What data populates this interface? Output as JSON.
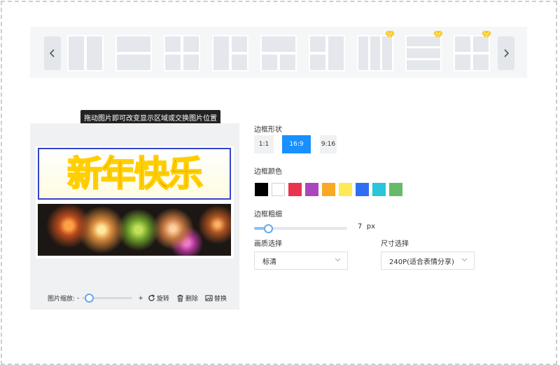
{
  "template_strip": {
    "prev_icon": "chevron-left-icon",
    "next_icon": "chevron-right-icon",
    "vip_icon": "diamond-icon",
    "vip_color": "#f5c518"
  },
  "editor": {
    "tooltip": "拖动图片即可改变显示区域或交换图片位置",
    "banner_text": "新年快乐",
    "zoom_label": "图片缩放:",
    "zoom_minus": "-",
    "zoom_plus": "+",
    "zoom_level": 0.05,
    "rotate_label": "旋转",
    "delete_label": "删除",
    "replace_label": "替换"
  },
  "settings": {
    "shape_label": "边框形状",
    "shapes": [
      "1:1",
      "16:9",
      "9:16"
    ],
    "shape_selected": "16:9",
    "color_label": "边框颜色",
    "colors": [
      "#000000",
      "#ffffff",
      "#e8344e",
      "#a847bd",
      "#f9a825",
      "#ffe957",
      "#2f6ef2",
      "#29c5dc",
      "#66bb6a"
    ],
    "width_label": "边框粗细",
    "width_value": "7",
    "width_unit": "px",
    "quality_label": "画质选择",
    "quality_value": "标清",
    "size_label": "尺寸选择",
    "size_value": "240P(适合表情分享)"
  }
}
